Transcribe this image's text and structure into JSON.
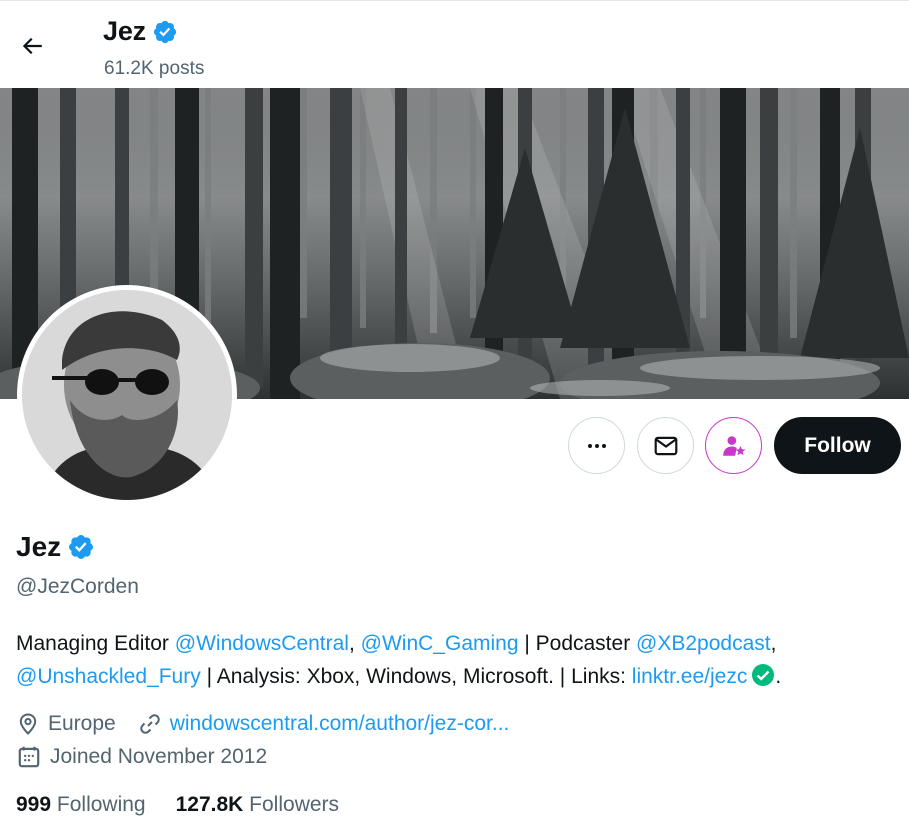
{
  "header": {
    "back_icon": "arrow-left-icon",
    "name": "Jez",
    "posts": "61.2K posts"
  },
  "profile": {
    "name": "Jez",
    "verified_icon": "verified-badge-icon",
    "handle": "@JezCorden",
    "bio": {
      "t1": "Managing Editor ",
      "m1": "@WindowsCentral",
      "t2": ", ",
      "m2": "@WinC_Gaming",
      "t3": " | Podcaster ",
      "m3": "@XB2podcast",
      "t4": ",",
      "m4": "@Unshackled_Fury",
      "t5": " | Analysis: Xbox, Windows, Microsoft. | Links: ",
      "link": "linktr.ee/jezc",
      "t6": "."
    },
    "location": "Europe",
    "website": "windowscentral.com/author/jez-cor...",
    "joined": "Joined November 2012",
    "following_count": "999",
    "following_label": "Following",
    "followers_count": "127.8K",
    "followers_label": "Followers"
  },
  "actions": {
    "more_icon": "more-dots-icon",
    "message_icon": "envelope-icon",
    "subscribe_icon": "subscribe-user-star-icon",
    "follow_label": "Follow"
  },
  "colors": {
    "accent": "#1d9bf0",
    "text": "#0f1419",
    "secondary": "#536471",
    "subscribe": "#c936cc",
    "green_check": "#00ba7c"
  }
}
